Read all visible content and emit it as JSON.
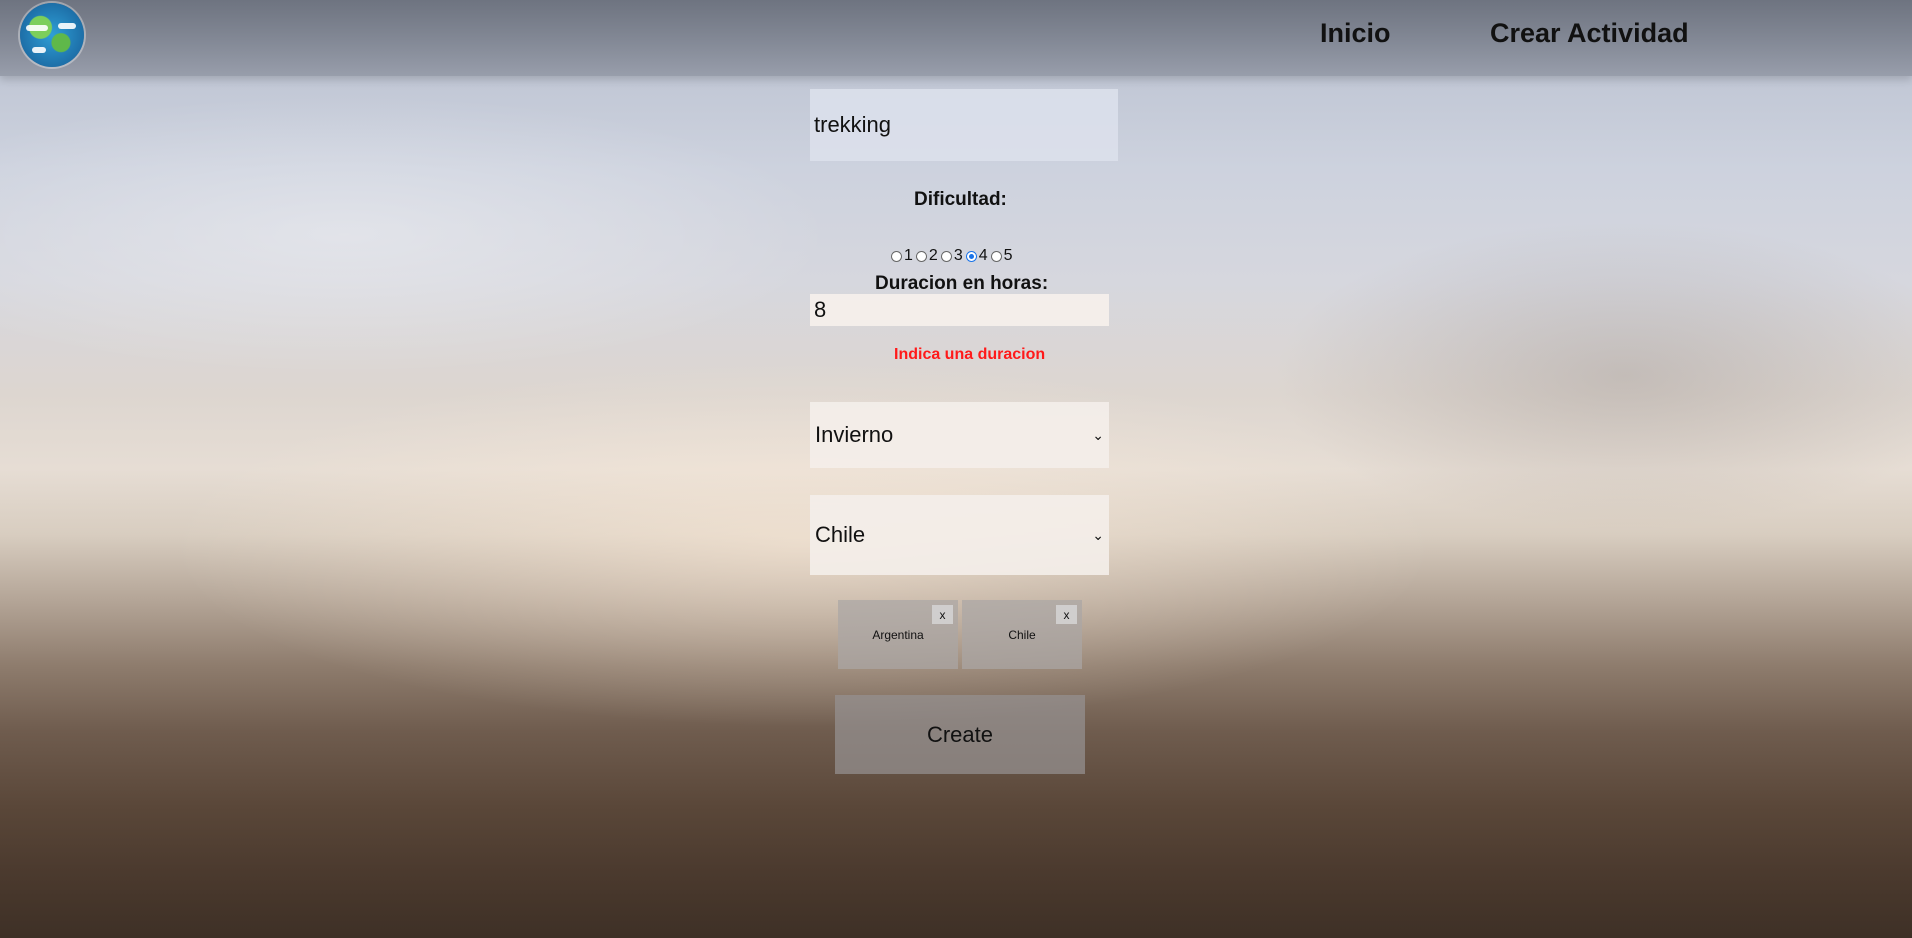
{
  "header": {
    "nav": {
      "home_label": "Inicio",
      "create_label": "Crear Actividad"
    },
    "logo_icon": "globe-icon"
  },
  "form": {
    "name": {
      "value": "trekking"
    },
    "difficulty": {
      "label": "Dificultad:",
      "options": [
        "1",
        "2",
        "3",
        "4",
        "5"
      ],
      "selected": "4"
    },
    "duration": {
      "label": "Duracion en horas:",
      "value": "8",
      "error": "Indica una duracion"
    },
    "season": {
      "selected": "Invierno"
    },
    "country": {
      "selected": "Chile"
    },
    "selected_countries": [
      {
        "name": "Argentina",
        "remove_label": "x"
      },
      {
        "name": "Chile",
        "remove_label": "x"
      }
    ],
    "submit_label": "Create"
  },
  "colors": {
    "error": "#ff1a1a",
    "radio_selected": "#1a73e8"
  }
}
